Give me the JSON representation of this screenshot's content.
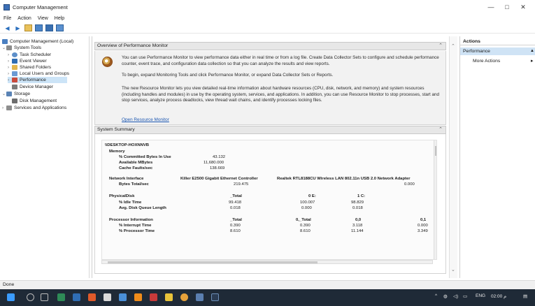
{
  "window": {
    "title": "Computer Management",
    "min_glyph": "—",
    "max_glyph": "□",
    "close_glyph": "✕"
  },
  "menu": [
    "File",
    "Action",
    "View",
    "Help"
  ],
  "toolbar": {
    "icons": [
      "back-arrow-icon",
      "forward-arrow-icon",
      "up-folder-icon",
      "show-hide-tree-icon",
      "help-icon",
      "properties-icon"
    ]
  },
  "tree": {
    "items": [
      {
        "label": "Computer Management (Local)",
        "icon": "computer-management-icon"
      },
      {
        "label": "System Tools",
        "icon": "tools-icon"
      },
      {
        "label": "Task Scheduler",
        "icon": "clock-icon"
      },
      {
        "label": "Event Viewer",
        "icon": "event-viewer-icon"
      },
      {
        "label": "Shared Folders",
        "icon": "shared-folder-icon"
      },
      {
        "label": "Local Users and Groups",
        "icon": "users-icon"
      },
      {
        "label": "Performance",
        "icon": "performance-icon"
      },
      {
        "label": "Device Manager",
        "icon": "device-manager-icon"
      },
      {
        "label": "Storage",
        "icon": "storage-icon"
      },
      {
        "label": "Disk Management",
        "icon": "disk-icon"
      },
      {
        "label": "Services and Applications",
        "icon": "services-icon"
      }
    ]
  },
  "overview": {
    "header": "Overview of Performance Monitor",
    "p1": "You can use Performance Monitor to view performance data either in real time or from a log file. Create Data Collector Sets to configure and schedule performance counter, event trace, and configuration data collection so that you can analyze the results and view reports.",
    "p2": "To begin, expand Monitoring Tools and click Performance Monitor, or expand Data Collector Sets or Reports.",
    "p3": "The new Resource Monitor lets you view detailed real-time information about hardware resources (CPU, disk, network, and memory) and system resources (including handles and modules) in use by the operating system, services, and applications. In addition, you can use Resource Monitor to stop processes, start and stop services, analyze process deadlocks, view thread wait chains, and identify processes locking files.",
    "link": "Open Resource Monitor"
  },
  "summary": {
    "header": "System Summary",
    "host": "\\\\DESKTOP-HOXNNVB",
    "memory": {
      "title": "Memory",
      "rows": [
        {
          "label": "% Committed Bytes In Use",
          "value": "43.132"
        },
        {
          "label": "Available MBytes",
          "value": "11,680.000"
        },
        {
          "label": "Cache Faults/sec",
          "value": "138.669"
        }
      ]
    },
    "network": {
      "title": "Network Interface",
      "col1": "Killer E2500 Gigabit Ethernet Controller",
      "col2": "Realtek RTL8188CU Wireless LAN 802.11n USB 2.0 Network Adapter",
      "row_label": "Bytes Total/sec",
      "v1": "219.475",
      "v2": "0.000"
    },
    "disk": {
      "title": "PhysicalDisk",
      "cols": [
        "_Total",
        "0 E:",
        "1 C:"
      ],
      "rows": [
        {
          "label": "% Idle Time",
          "values": [
            "99.418",
            "100.007",
            "98.829"
          ]
        },
        {
          "label": "Avg. Disk Queue Length",
          "values": [
            "0.018",
            "0.000",
            "0.018"
          ]
        }
      ]
    },
    "processor": {
      "title": "Processor Information",
      "cols": [
        "_Total",
        "0,_Total",
        "0,0",
        "0,1"
      ],
      "rows": [
        {
          "label": "% Interrupt Time",
          "values": [
            "0.390",
            "0.390",
            "3.118",
            "0.000"
          ]
        },
        {
          "label": "% Processor Time",
          "values": [
            "8.610",
            "8.610",
            "11.144",
            "3.349"
          ]
        }
      ]
    }
  },
  "actions": {
    "header": "Actions",
    "section": "Performance",
    "item": "More Actions"
  },
  "status": "Done",
  "taskbar": {
    "tray_lang": "ENG",
    "tray_time": "02:00 م"
  },
  "colors": {
    "accent": "#cce4f7",
    "taskbar": "#1f2a37",
    "link": "#1a55b0"
  }
}
